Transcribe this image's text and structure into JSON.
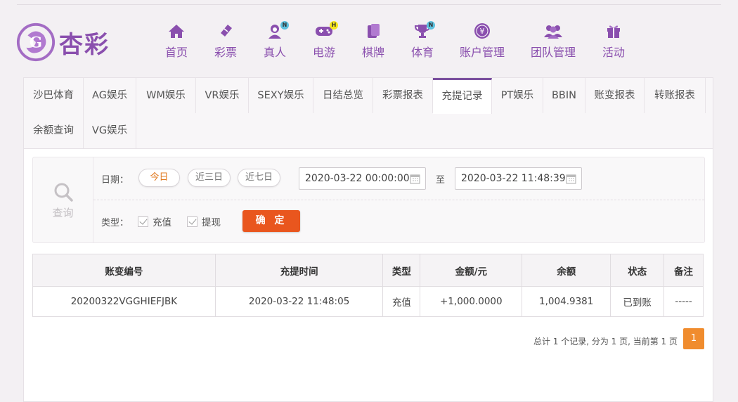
{
  "brand": {
    "logo_text": "杏彩",
    "accent": "#8a4fae"
  },
  "nav": [
    {
      "label": "首页",
      "icon": "home-icon"
    },
    {
      "label": "彩票",
      "icon": "ticket-icon"
    },
    {
      "label": "真人",
      "icon": "dealer-icon",
      "badge": "N"
    },
    {
      "label": "电游",
      "icon": "gamepad-icon",
      "badge": "H"
    },
    {
      "label": "棋牌",
      "icon": "cards-icon"
    },
    {
      "label": "体育",
      "icon": "trophy-icon",
      "badge": "N"
    },
    {
      "label": "账户管理",
      "icon": "yen-coin-icon"
    },
    {
      "label": "团队管理",
      "icon": "team-icon"
    },
    {
      "label": "活动",
      "icon": "gift-icon"
    }
  ],
  "tabs": [
    "沙巴体育",
    "AG娱乐",
    "WM娱乐",
    "VR娱乐",
    "SEXY娱乐",
    "日结总览",
    "彩票报表",
    "充提记录",
    "PT娱乐",
    "BBIN",
    "账变报表",
    "转账报表",
    "余额查询",
    "VG娱乐"
  ],
  "active_tab": "充提记录",
  "search": {
    "side_label": "查询",
    "date_label": "日期：",
    "quick_ranges": [
      "今日",
      "近三日",
      "近七日"
    ],
    "active_range": "今日",
    "start": "2020-03-22 00:00:00",
    "to_label": "至",
    "end": "2020-03-22 11:48:39",
    "type_label": "类型：",
    "types": [
      "充值",
      "提现"
    ],
    "confirm_label": "确 定"
  },
  "table": {
    "headers": [
      "账变编号",
      "充提时间",
      "类型",
      "金额/元",
      "余额",
      "状态",
      "备注"
    ],
    "rows": [
      [
        "20200322VGGHIEFJBK",
        "2020-03-22 11:48:05",
        "充值",
        "+1,000.0000",
        "1,004.9381",
        "已到账",
        "-----"
      ]
    ]
  },
  "pager": {
    "summary": "总计 1 个记录, 分为 1 页, 当前第 1 页",
    "current": "1"
  }
}
